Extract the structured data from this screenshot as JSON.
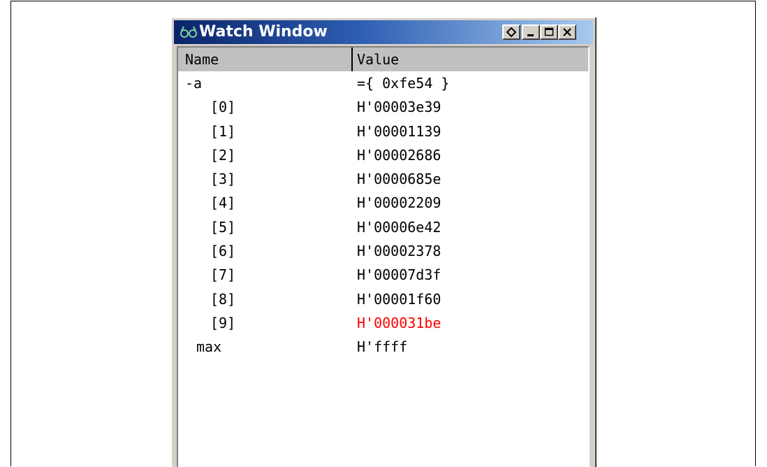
{
  "window": {
    "title": "Watch Window",
    "buttons": [
      "options",
      "minimize",
      "maximize",
      "close"
    ]
  },
  "columns": {
    "name": "Name",
    "value": "Value"
  },
  "rows": [
    {
      "name": "-a",
      "value": "={ 0xfe54 }"
    },
    {
      "name": "[0]",
      "value": "H'00003e39"
    },
    {
      "name": "[1]",
      "value": "H'00001139"
    },
    {
      "name": "[2]",
      "value": "H'00002686"
    },
    {
      "name": "[3]",
      "value": "H'0000685e"
    },
    {
      "name": "[4]",
      "value": "H'00002209"
    },
    {
      "name": "[5]",
      "value": "H'00006e42"
    },
    {
      "name": "[6]",
      "value": "H'00002378"
    },
    {
      "name": "[7]",
      "value": "H'00007d3f"
    },
    {
      "name": "[8]",
      "value": "H'00001f60"
    },
    {
      "name": "[9]",
      "value": "H'000031be",
      "changed": true
    },
    {
      "name": "max",
      "value": "H'ffff"
    }
  ],
  "colors": {
    "title_bar": "#0a246a",
    "changed_value": "#ff0000",
    "header_bg": "#c0c0c0"
  }
}
